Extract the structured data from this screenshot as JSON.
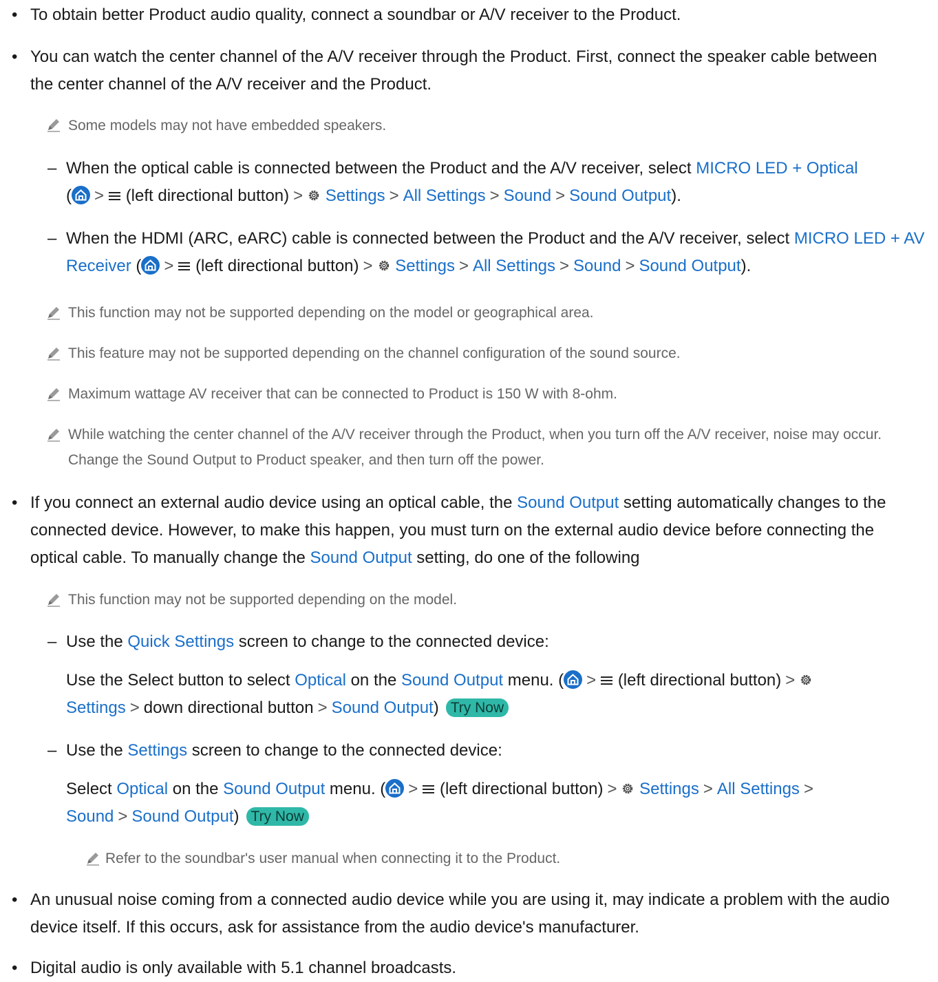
{
  "bullet_symbol": "•",
  "dash_symbol": "–",
  "separator": ">",
  "p1": "To obtain better Product audio quality, connect a soundbar or A/V receiver to the Product.",
  "p2": "You can watch the center channel of the A/V receiver through the Product. First, connect the speaker cable between the center channel of the A/V receiver and the Product.",
  "n1": "Some models may not have embedded speakers.",
  "d1": {
    "pre": "When the optical cable is connected between the Product and the A/V receiver, select ",
    "link": "MICRO LED + Optical",
    "left_btn": "(left directional button)",
    "settings": "Settings",
    "all_settings": "All Settings",
    "sound": "Sound",
    "sound_output": "Sound Output"
  },
  "d2": {
    "pre": "When the HDMI (ARC, eARC) cable is connected between the Product and the A/V receiver, select ",
    "link": "MICRO LED + AV Receiver",
    "left_btn": "(left directional button)",
    "settings": "Settings",
    "all_settings": "All Settings",
    "sound": "Sound",
    "sound_output": "Sound Output"
  },
  "n2": "This function may not be supported depending on the model or geographical area.",
  "n3": "This feature may not be supported depending on the channel configuration of the sound source.",
  "n4": "Maximum wattage AV receiver that can be connected to Product is 150 W with 8-ohm.",
  "n5": "While watching the center channel of the A/V receiver through the Product, when you turn off the A/V receiver, noise may occur. Change the Sound Output to Product speaker, and then turn off the power.",
  "p3": {
    "a": "If you connect an external audio device using an optical cable, the ",
    "link1": "Sound Output",
    "b": " setting automatically changes to the connected device. However, to make this happen, you must turn on the external audio device before connecting the optical cable. To manually change the ",
    "link2": "Sound Output",
    "c": " setting, do one of the following"
  },
  "n6": "This function may not be supported depending on the model.",
  "d3": {
    "a": "Use the ",
    "link": "Quick Settings",
    "b": " screen to change to the connected device:"
  },
  "s3": {
    "a": "Use the Select button to select ",
    "optical": "Optical",
    "b": " on the ",
    "sound_output": "Sound Output",
    "c": " menu. (",
    "left_btn": "(left directional button)",
    "settings": "Settings",
    "down_btn": "down directional button",
    "sound_output2": "Sound Output",
    "close": ")",
    "try_now": "Try Now"
  },
  "d4": {
    "a": "Use the ",
    "link": "Settings",
    "b": " screen to change to the connected device:"
  },
  "s4": {
    "a": "Select ",
    "optical": "Optical",
    "b": " on the ",
    "sound_output": "Sound Output",
    "c": " menu. (",
    "left_btn": "(left directional button)",
    "settings": "Settings",
    "all_settings": "All Settings",
    "sound": "Sound",
    "sound_output2": "Sound Output",
    "close": ")",
    "try_now": "Try Now"
  },
  "n7": "Refer to the soundbar's user manual when connecting it to the Product.",
  "p4": "An unusual noise coming from a connected audio device while you are using it, may indicate a problem with the audio device itself. If this occurs, ask for assistance from the audio device's manufacturer.",
  "p5": "Digital audio is only available with 5.1 channel broadcasts.",
  "icons": [
    "pencil-note-icon",
    "home-icon",
    "menu-icon",
    "gear-icon"
  ],
  "colors": {
    "link": "#1a6fc9",
    "note": "#666666",
    "try_now_bg": "#2fb8a8",
    "text": "#1a1a1a"
  }
}
